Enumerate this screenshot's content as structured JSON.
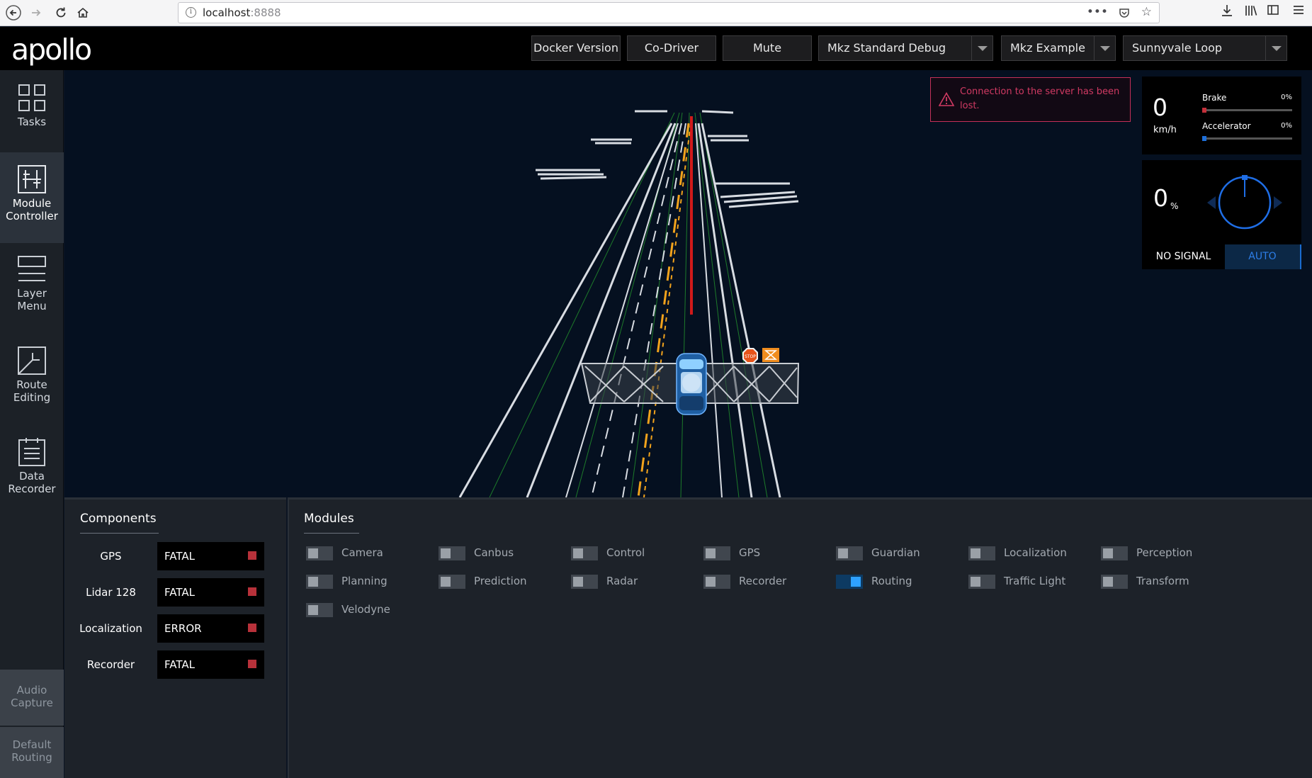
{
  "browser": {
    "url_host": "localhost",
    "url_port": ":8888"
  },
  "header": {
    "logo": "apollo",
    "buttons": {
      "docker_version": "Docker Version",
      "co_driver": "Co-Driver",
      "mute": "Mute"
    },
    "selects": {
      "mode": "Mkz Standard Debug",
      "vehicle": "Mkz Example",
      "map": "Sunnyvale Loop"
    }
  },
  "sidebar": {
    "items": [
      {
        "label_line1": "Tasks",
        "label_line2": ""
      },
      {
        "label_line1": "Module",
        "label_line2": "Controller"
      },
      {
        "label_line1": "Layer",
        "label_line2": "Menu"
      },
      {
        "label_line1": "Route",
        "label_line2": "Editing"
      },
      {
        "label_line1": "Data",
        "label_line2": "Recorder"
      },
      {
        "label_line1": "Audio",
        "label_line2": "Capture"
      },
      {
        "label_line1": "Default",
        "label_line2": "Routing"
      }
    ]
  },
  "scene": {
    "alert": "Connection to the server has been lost.",
    "stop_sign": "STOP"
  },
  "dashboard": {
    "speed": "0",
    "speed_unit": "km/h",
    "brake_label": "Brake",
    "brake_pct": "0%",
    "brake_value": 0,
    "accel_label": "Accelerator",
    "accel_pct": "0%",
    "accel_value": 0,
    "steering": "0",
    "steering_unit": "%",
    "signal": "NO SIGNAL",
    "drive_mode": "AUTO",
    "colors": {
      "brake": "#c4303a",
      "accel": "#1e6fd9",
      "wheel": "#1f6ee6"
    }
  },
  "components": {
    "title": "Components",
    "items": [
      {
        "name": "GPS",
        "status": "FATAL"
      },
      {
        "name": "Lidar 128",
        "status": "FATAL"
      },
      {
        "name": "Localization",
        "status": "ERROR"
      },
      {
        "name": "Recorder",
        "status": "FATAL"
      }
    ]
  },
  "modules": {
    "title": "Modules",
    "items": [
      {
        "name": "Camera",
        "on": false
      },
      {
        "name": "Canbus",
        "on": false
      },
      {
        "name": "Control",
        "on": false
      },
      {
        "name": "GPS",
        "on": false
      },
      {
        "name": "Guardian",
        "on": false
      },
      {
        "name": "Localization",
        "on": false
      },
      {
        "name": "Perception",
        "on": false
      },
      {
        "name": "Planning",
        "on": false
      },
      {
        "name": "Prediction",
        "on": false
      },
      {
        "name": "Radar",
        "on": false
      },
      {
        "name": "Recorder",
        "on": false
      },
      {
        "name": "Routing",
        "on": true
      },
      {
        "name": "Traffic Light",
        "on": false
      },
      {
        "name": "Transform",
        "on": false
      },
      {
        "name": "Velodyne",
        "on": false
      }
    ]
  }
}
